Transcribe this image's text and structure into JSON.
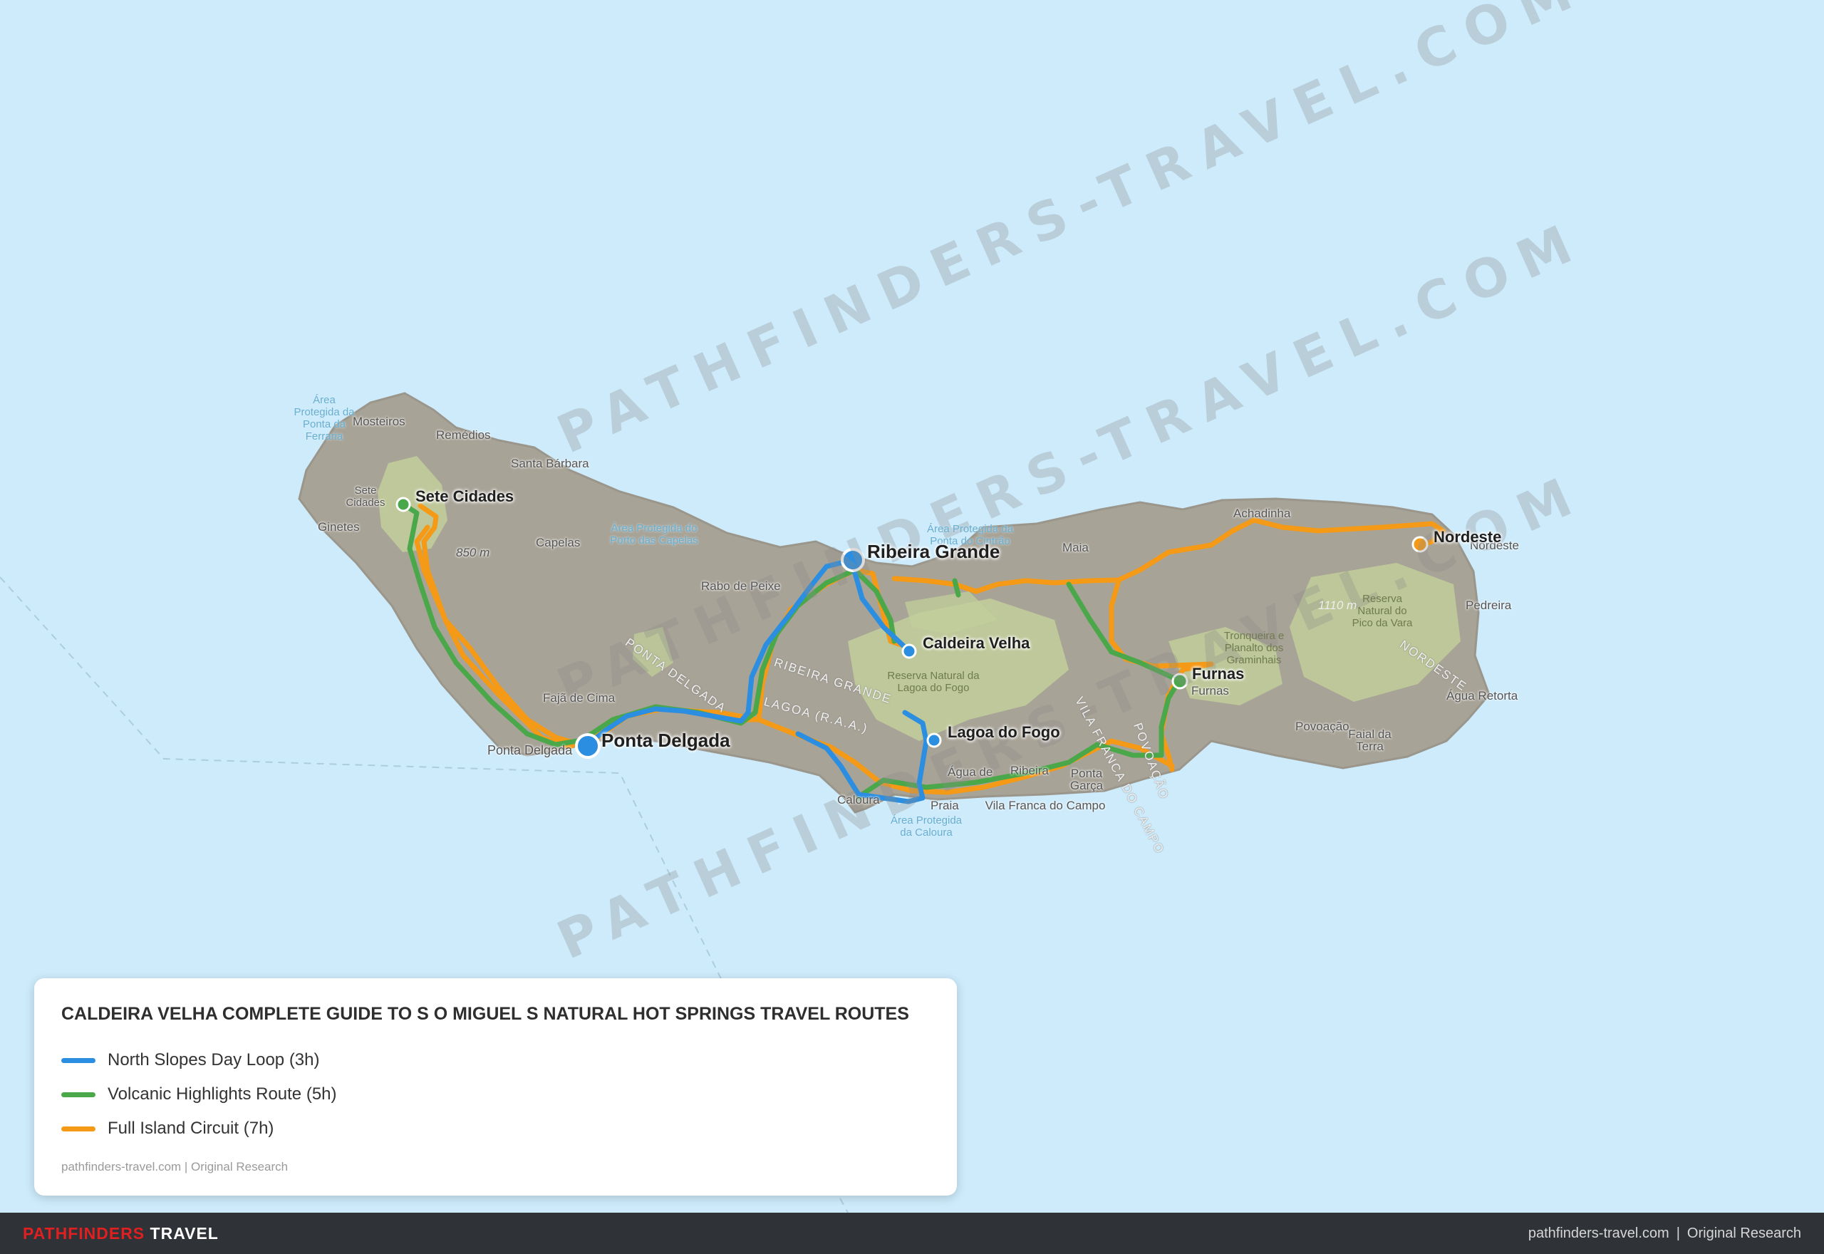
{
  "map": {
    "title": "CALDEIRA VELHA COMPLETE GUIDE TO S O MIGUEL S NATURAL HOT SPRINGS TRAVEL ROUTES",
    "watermark_text": "PATHFINDERS-TRAVEL.COM",
    "colors": {
      "water": "#cdebfb",
      "land": "#a8a397",
      "park": "#c2cf9a",
      "blue_route": "#2b8ee0",
      "green_route": "#4aa84a",
      "orange_route": "#f59a16"
    },
    "routes": [
      {
        "name": "North Slopes Day Loop (3h)",
        "color": "#2b8ee0"
      },
      {
        "name": "Volcanic Highlights Route (5h)",
        "color": "#4aa84a"
      },
      {
        "name": "Full Island Circuit (7h)",
        "color": "#f59a16"
      }
    ],
    "poi_labels": {
      "sete_cidades": "Sete Cidades",
      "ribeira_grande": "Ribeira Grande",
      "caldeira_velha": "Caldeira Velha",
      "furnas": "Furnas",
      "lagoa_do_fogo": "Lagoa do Fogo",
      "ponta_delgada": "Ponta Delgada",
      "nordeste": "Nordeste"
    },
    "base_labels": {
      "mosteiros": "Mosteiros",
      "remedios": "Remédios",
      "santa_barbara": "Santa Bárbara",
      "ginetes": "Ginetes",
      "capelas": "Capelas",
      "rabo_de_peixe": "Rabo de Peixe",
      "maia": "Maia",
      "achadinha": "Achadinha",
      "nordeste_small": "Nordeste",
      "pedreira": "Pedreira",
      "agua_retorta": "Água Retorta",
      "povoacao": "Povoação",
      "faja_de_cima": "Fajã de Cima",
      "ponta_delgada_small": "Ponta Delgada",
      "praia": "Praia",
      "caloura": "Caloura",
      "agua_de_pau": "Água de",
      "ribeira_small": "Ribeira",
      "ponta_garca": "Ponta Garça",
      "vila_franca": "Vila Franca do Campo",
      "furnas_small": "Furnas",
      "faial_da_terra": "Faial da Terra",
      "elevation_850": "850 m",
      "elevation_1110": "1110 m"
    },
    "area_labels": {
      "protegida_ponta_ferraria": "Área Protegida da Ponta da Ferraria",
      "sete_cidades_small": "Sete Cidades",
      "porto_capelas": "Área Protegida do Porto das Capelas",
      "porto_calhau": "Área Protegida da Ponta do Cintrão",
      "agua_de_pau_reserve": "Reserva Natural da Lagoa do Fogo",
      "pico_da_vara": "Reserva Natural do Pico da Vara",
      "tronqueira": "Tronqueira e Planalto dos Graminhais",
      "caloura_area": "Área Protegida da Caloura"
    },
    "road_labels": {
      "ponta_delgada_road": "PONTA DELGADA",
      "ribeira_grande_road": "RIBEIRA GRANDE",
      "lagoa_road": "LAGOA (R.A.A.)",
      "vila_franca_road": "VILA FRANCA DO CAMPO",
      "povoacao_road": "POVOAÇÃO",
      "nordeste_road": "NORDESTE"
    },
    "legend_source": "pathfinders-travel.com | Original Research"
  },
  "footer": {
    "brand_accent": "PATHFINDERS",
    "brand_main": "TRAVEL",
    "site": "pathfinders-travel.com",
    "separator": "|",
    "note": "Original Research"
  }
}
